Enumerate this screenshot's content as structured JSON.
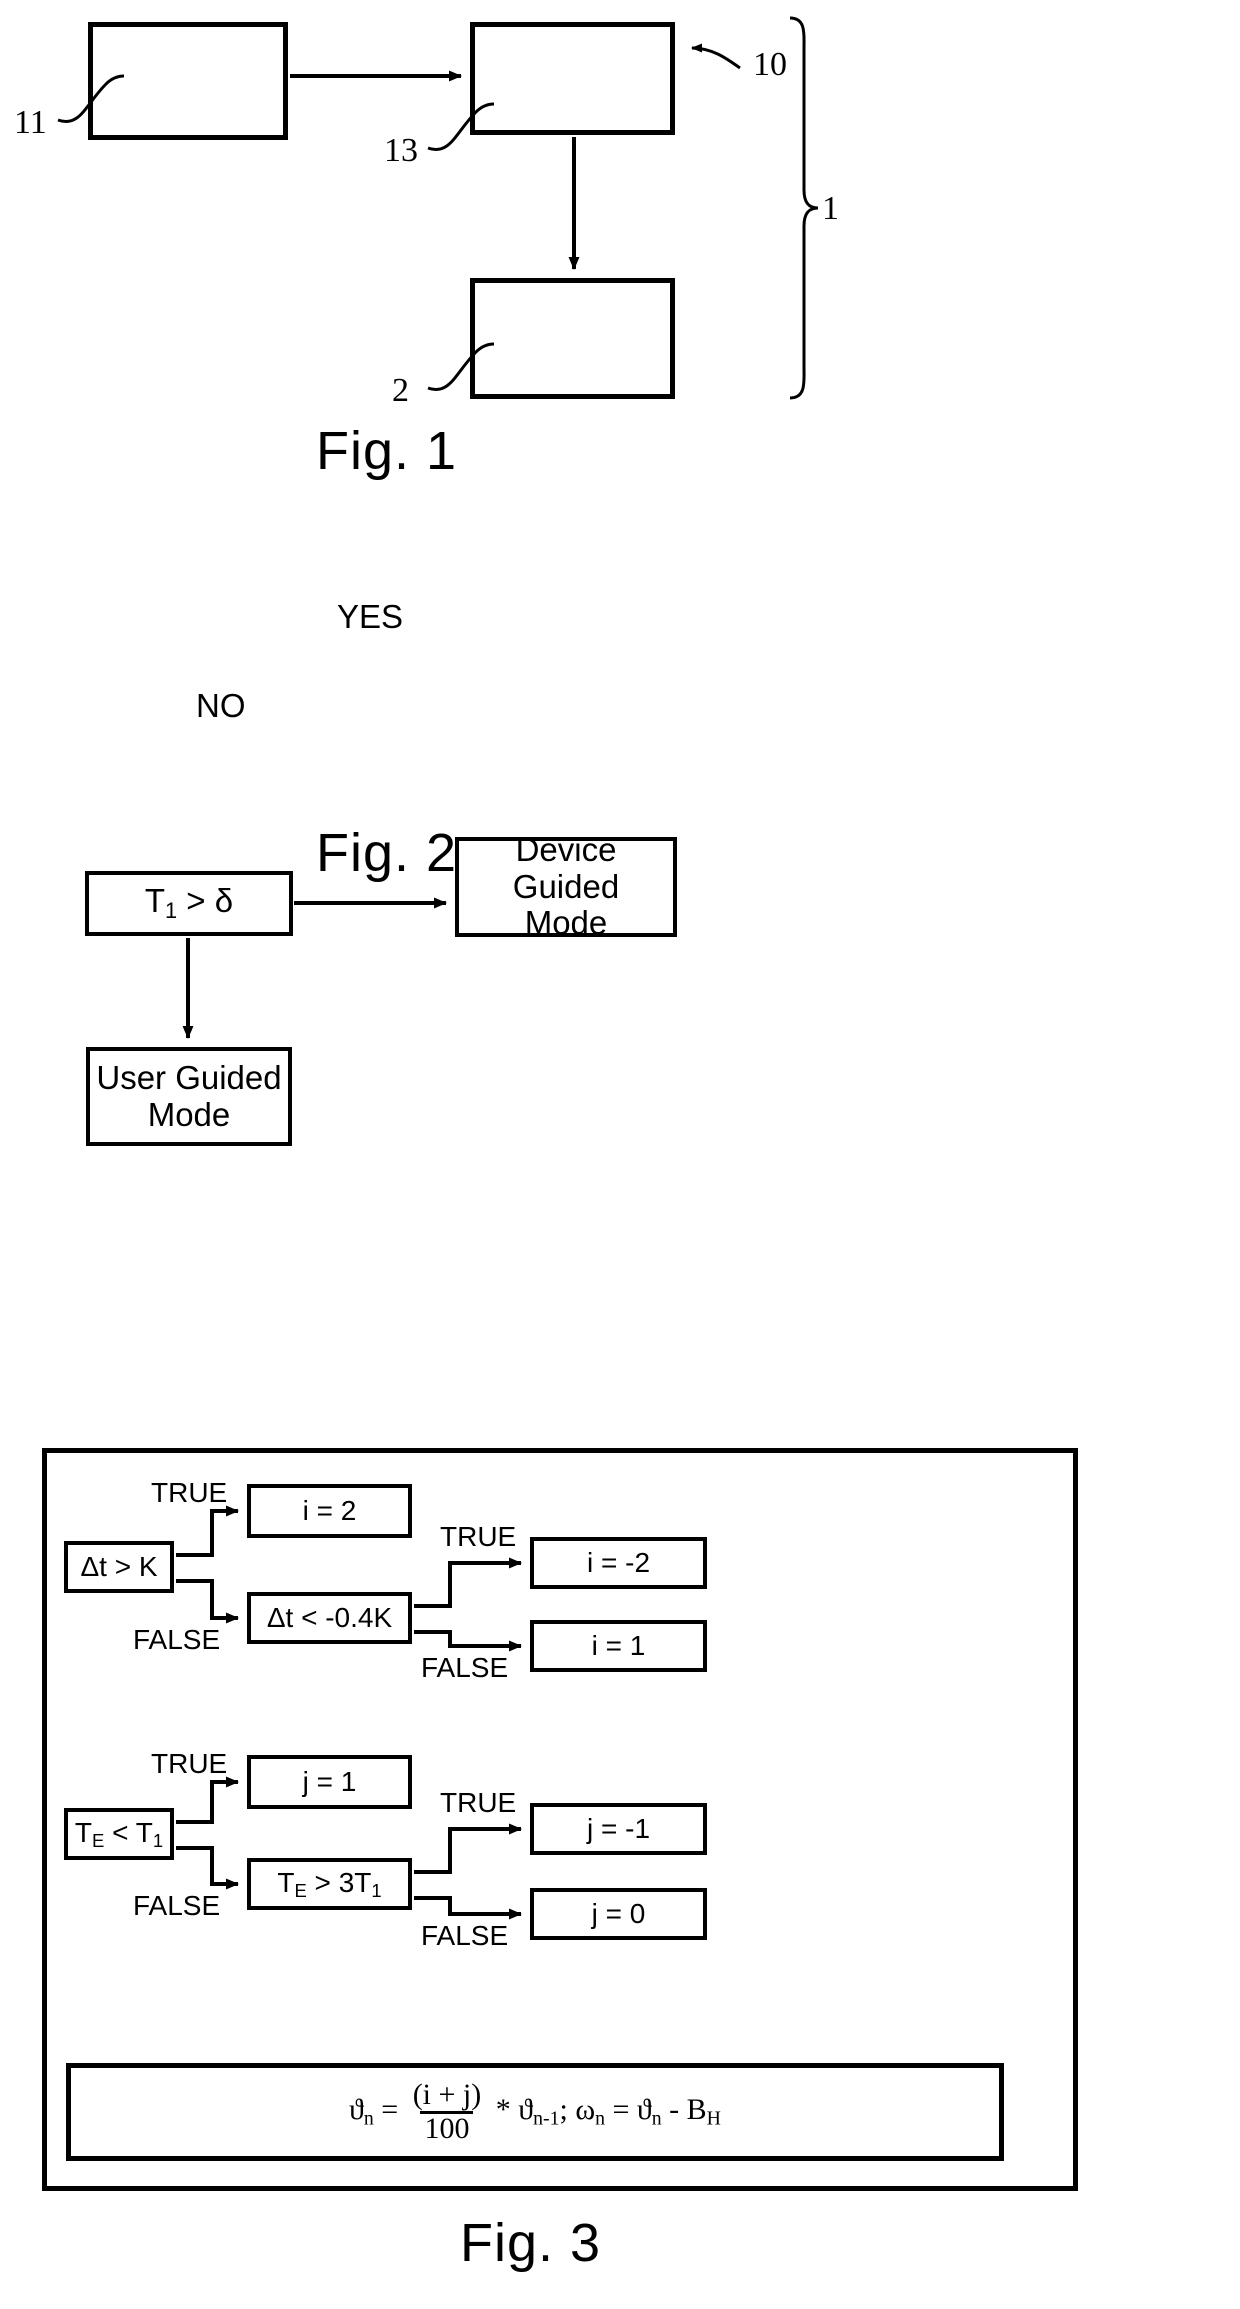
{
  "document": {
    "type": "patent-drawing-sheet",
    "figures": [
      "Fig. 1",
      "Fig. 2",
      "Fig. 3"
    ]
  },
  "fig1": {
    "caption": "Fig. 1",
    "boxes": [
      {
        "id": "box-11",
        "label": "",
        "ref": "11"
      },
      {
        "id": "box-13",
        "label": "",
        "ref": "13"
      },
      {
        "id": "box-2",
        "label": "",
        "ref": "2"
      }
    ],
    "refs": {
      "ref_11": "11",
      "ref_13": "13",
      "ref_10": "10",
      "ref_2": "2",
      "ref_1": "1"
    }
  },
  "fig2": {
    "caption": "Fig. 2",
    "decision": "T1 > δ",
    "decision_base": "T",
    "decision_sub": "1",
    "decision_tail": " > δ",
    "yes_label": "YES",
    "no_label": "NO",
    "device_mode_line1": "Device Guided",
    "device_mode_line2": "Mode",
    "user_mode_line1": "User Guided",
    "user_mode_line2": "Mode"
  },
  "fig3": {
    "caption": "Fig. 3",
    "branch1": {
      "decision": "Δt > K",
      "true_label": "TRUE",
      "false_label": "FALSE",
      "true_result": "i = 2",
      "sub_decision": "Δt < -0.4K",
      "sub_true_label": "TRUE",
      "sub_false_label": "FALSE",
      "sub_true_result": "i = -2",
      "sub_false_result": "i = 1"
    },
    "branch2": {
      "decision_base": "T",
      "decision_sub": "E",
      "decision_mid": " < T",
      "decision_sub2": "1",
      "true_label": "TRUE",
      "false_label": "FALSE",
      "true_result": "j = 1",
      "sub_decision_base": "T",
      "sub_decision_sub": "E",
      "sub_decision_mid": " > 3T",
      "sub_decision_sub2": "1",
      "sub_true_label": "TRUE",
      "sub_false_label": "FALSE",
      "sub_true_result": "j = -1",
      "sub_false_result": "j = 0"
    },
    "formula": {
      "lhs_base": "ϑ",
      "lhs_sub": "n",
      "eq": "=",
      "numerator": "(i + j)",
      "denominator": "100",
      "times": "*",
      "prev_base": "ϑ",
      "prev_sub": "n-1",
      "semicolon": ";",
      "omega_base": "ω",
      "omega_sub": "n",
      "eq2": "=",
      "theta_base": "ϑ",
      "theta_sub": "n",
      "minus": "-",
      "bh_base": "B",
      "bh_sub": "H"
    }
  },
  "colors": {
    "ink": "#000000",
    "paper": "#ffffff"
  }
}
